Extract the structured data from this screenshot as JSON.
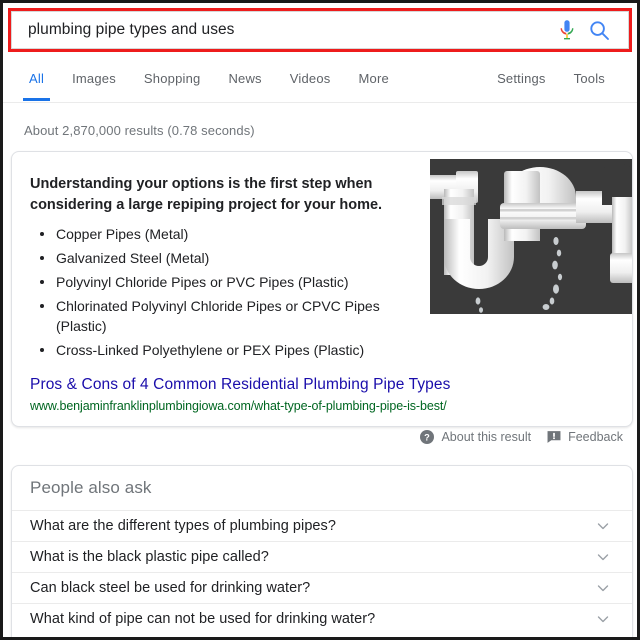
{
  "search": {
    "query": "plumbing pipe types and uses",
    "placeholder": "Search",
    "mic_icon": "microphone-icon",
    "search_icon": "search-icon",
    "highlight_color": "#ee1c1c"
  },
  "nav": {
    "left_tabs": [
      {
        "label": "All",
        "active": true
      },
      {
        "label": "Images",
        "active": false
      },
      {
        "label": "Shopping",
        "active": false
      },
      {
        "label": "News",
        "active": false
      },
      {
        "label": "Videos",
        "active": false
      },
      {
        "label": "More",
        "active": false
      }
    ],
    "right_tabs": [
      {
        "label": "Settings"
      },
      {
        "label": "Tools"
      }
    ],
    "active_color": "#1a73e8"
  },
  "result_stats": "About 2,870,000 results (0.78 seconds)",
  "featured_snippet": {
    "heading": "Understanding your options is the first step when considering a large repiping project for your home.",
    "bullets": [
      "Copper Pipes (Metal)",
      "Galvanized Steel (Metal)",
      "Polyvinyl Chloride Pipes or PVC Pipes (Plastic)",
      "Chlorinated Polyvinyl Chloride Pipes or CPVC Pipes (Plastic)",
      "Cross-Linked Polyethylene or PEX Pipes (Plastic)"
    ],
    "title": "Pros & Cons of 4 Common Residential Plumbing Pipe Types",
    "title_color": "#1a0dab",
    "url": "www.benjaminfranklinplumbingiowa.com/what-type-of-plumbing-pipe-is-best/",
    "url_color": "#006621",
    "thumbnail_alt": "white-pvc-p-trap-pipe-dripping-water-photo"
  },
  "meta": {
    "about_label": "About this result",
    "about_icon": "help-circle-icon",
    "feedback_label": "Feedback",
    "feedback_icon": "feedback-flag-icon"
  },
  "people_also_ask": {
    "title": "People also ask",
    "questions": [
      "What are the different types of plumbing pipes?",
      "What is the black plastic pipe called?",
      "Can black steel be used for drinking water?",
      "What kind of pipe can not be used for drinking water?"
    ],
    "expand_icon": "chevron-down-icon"
  }
}
